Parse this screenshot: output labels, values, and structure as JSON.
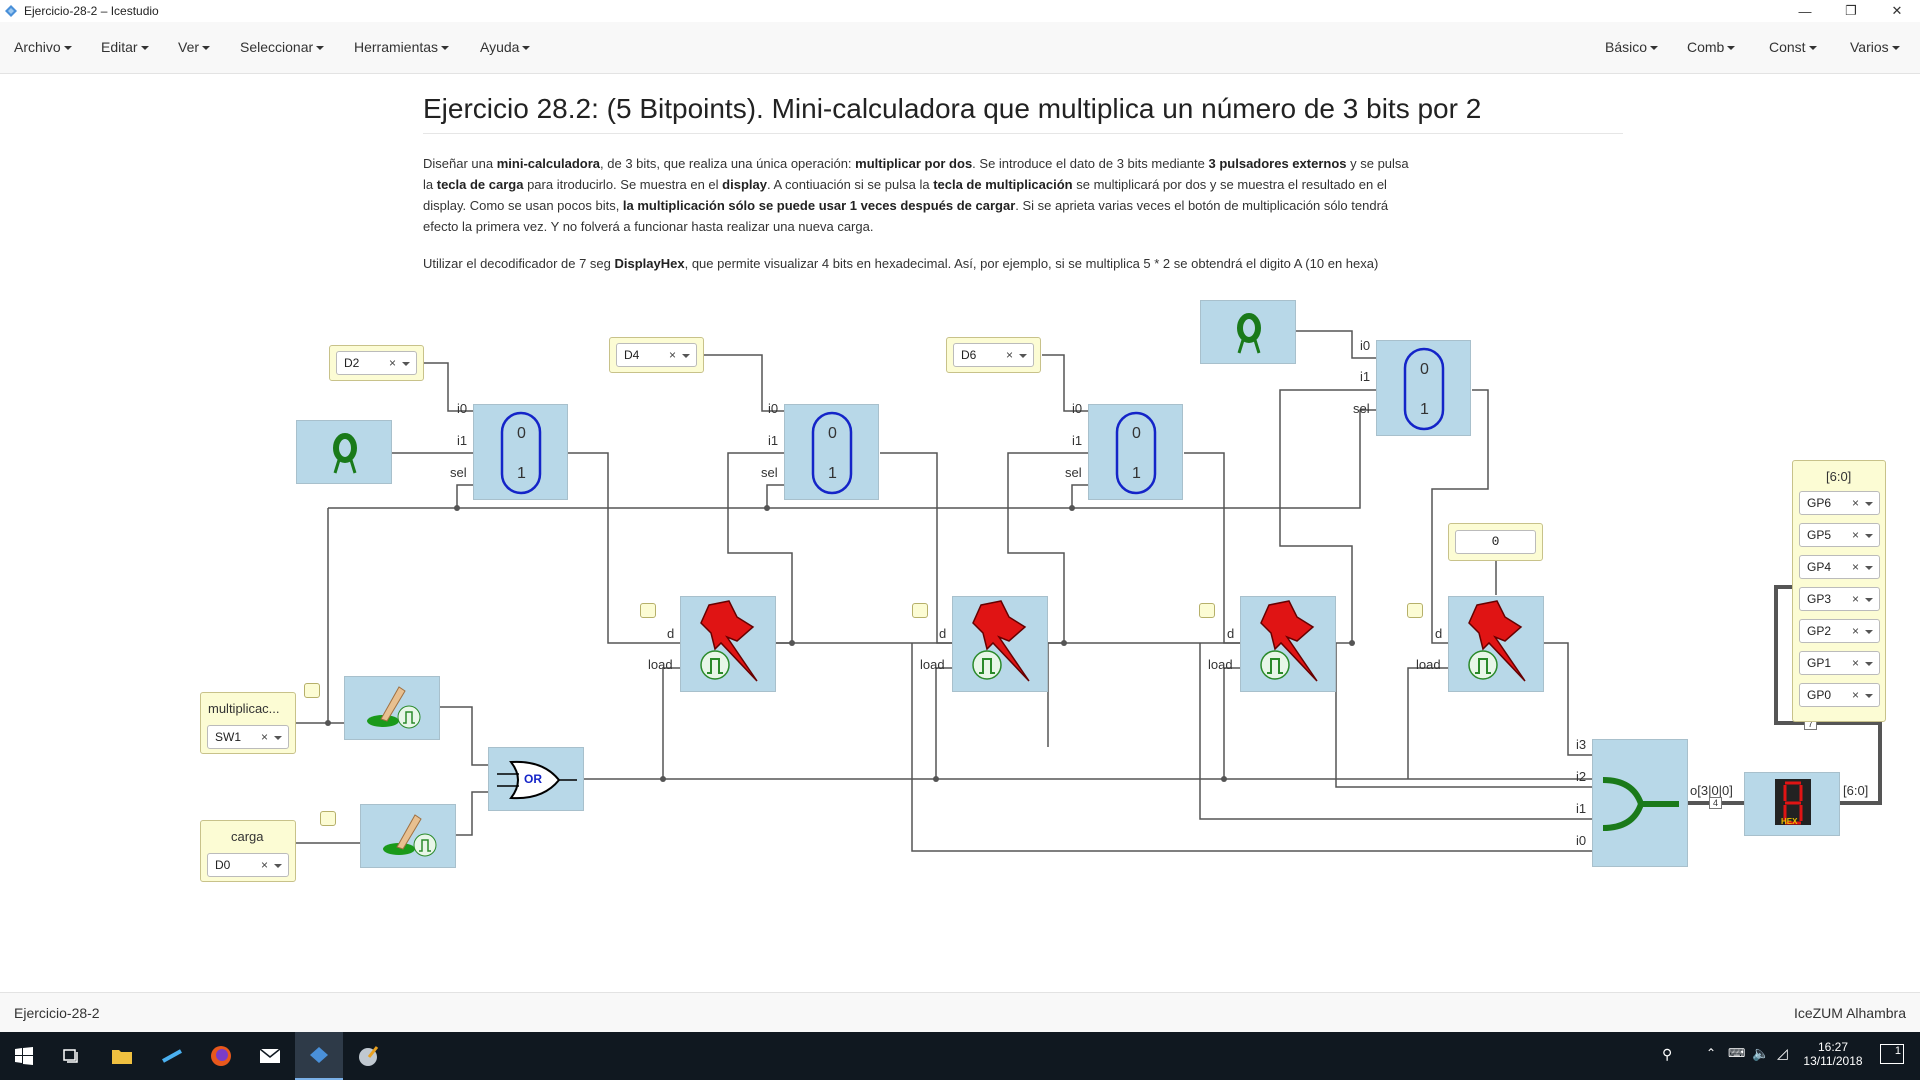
{
  "window": {
    "title": "Ejercicio-28-2 – Icestudio",
    "minimize": "—",
    "maximize": "❐",
    "close": "✕"
  },
  "menu": {
    "left": [
      "Archivo",
      "Editar",
      "Ver",
      "Seleccionar",
      "Herramientas",
      "Ayuda"
    ],
    "right": [
      "Básico",
      "Comb",
      "Const",
      "Varios"
    ]
  },
  "doc": {
    "title": "Ejercicio 28.2: (5 Bitpoints). Mini-calculadora que multiplica un número de 3 bits por 2",
    "p1": [
      {
        "t": "Diseñar una "
      },
      {
        "b": "mini-calculadora"
      },
      {
        "t": ", de 3 bits, que realiza una única operación: "
      },
      {
        "b": "multiplicar por dos"
      },
      {
        "t": ". Se introduce el dato de 3 bits mediante "
      },
      {
        "b": "3 pulsadores externos"
      },
      {
        "t": " y se pulsa la "
      },
      {
        "b": "tecla de carga"
      },
      {
        "t": " para itroducirlo. Se muestra en el "
      },
      {
        "b": "display"
      },
      {
        "t": ". A contiuación si se pulsa la "
      },
      {
        "b": "tecla de multiplicación"
      },
      {
        "t": " se multiplicará por dos y se muestra el resultado en el display. Como se usan pocos bits, "
      },
      {
        "b": "la multiplicación sólo se puede usar 1 veces después de cargar"
      },
      {
        "t": ". Si se aprieta varias veces el botón de multiplicación sólo tendrá efecto la primera vez. Y no folverá a funcionar hasta realizar una nueva carga."
      }
    ],
    "p2": [
      {
        "t": "Utilizar el decodificador de 7 seg "
      },
      {
        "b": "DisplayHex"
      },
      {
        "t": ", que permite visualizar 4 bits en hexadecimal. Así, por ejemplo, si se multiplica 5 * 2 se obtendrá el digito A (10 en hexa)"
      }
    ]
  },
  "inputs": {
    "d2": {
      "pin": "D2",
      "clear": "×"
    },
    "d4": {
      "pin": "D4",
      "clear": "×"
    },
    "d6": {
      "pin": "D6",
      "clear": "×"
    },
    "mult": {
      "name": "multiplicac...",
      "pin": "SW1",
      "clear": "×"
    },
    "carga": {
      "name": "carga",
      "pin": "D0",
      "clear": "×"
    }
  },
  "constant": {
    "value": "0"
  },
  "output": {
    "name": "[6:0]",
    "pins": [
      "GP6",
      "GP5",
      "GP4",
      "GP3",
      "GP2",
      "GP1",
      "GP0"
    ],
    "clear": "×"
  },
  "mux_labels": {
    "i0": "i0",
    "i1": "i1",
    "sel": "sel",
    "zero": "0",
    "one": "1"
  },
  "reg_labels": {
    "d": "d",
    "load": "load"
  },
  "joiner_labels": {
    "i3": "i3",
    "i2": "i2",
    "i1": "i1",
    "i0": "i0",
    "out": "o[3|0|0]",
    "bus4": "4"
  },
  "display_labels": {
    "out": "[6:0]",
    "bus7": "7",
    "hex": "HEX"
  },
  "or_gate": {
    "label": "OR"
  },
  "statusbar": {
    "left": "Ejercicio-28-2",
    "right": "IceZUM Alhambra"
  },
  "taskbar": {
    "time": "16:27",
    "date": "13/11/2018",
    "notif": "1"
  }
}
